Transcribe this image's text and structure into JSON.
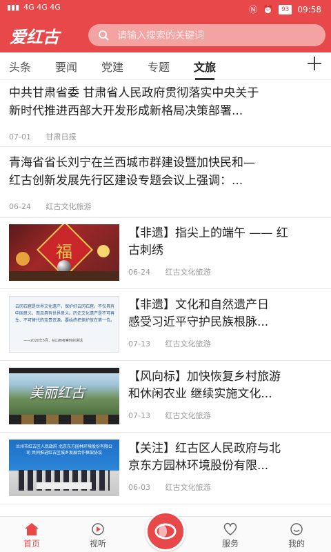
{
  "status_bar": {
    "left": "4G 4G 4G",
    "battery": "93",
    "time": "09:58"
  },
  "header": {
    "logo": "爱红古",
    "search_placeholder": "请输入搜索的关键词"
  },
  "tabs": [
    {
      "label": "头条"
    },
    {
      "label": "要闻"
    },
    {
      "label": "党建"
    },
    {
      "label": "专题"
    },
    {
      "label": "文旅"
    }
  ],
  "articles": [
    {
      "title_line1": "中共甘肃省委 甘肃省人民政府贯彻落实中央关于",
      "title_line2": "新时代推进西部大开发形成新格局决策部署...",
      "date": "07-01",
      "source": "甘肃日报"
    },
    {
      "title_line1": "青海省省长刘宁在兰西城市群建设暨加快民和—",
      "title_line2": "红古创新发展先行区建设专题会议上强调：...",
      "date": "06-24",
      "source": "红古文化旅游"
    }
  ],
  "cards": [
    {
      "title_line1": "【非遗】指尖上的端午 —— 红",
      "title_line2": "古刺绣",
      "date": "06-24",
      "source": "红古文化旅游",
      "thumb_text": "福"
    },
    {
      "title_line1": "【非遗】文化和自然遗产日",
      "title_line2": "感受习近平守护民族根脉...",
      "date": "07-13",
      "source": "红古文化旅游",
      "thumb_text": "云冈石窟是世界文化遗产，保护好云冈石窟，不仅具有中国意义，而且具有世界意义。历史文化遗产是不可再生、不可替代的宝贵资源，要始终把保护放在第一位。",
      "thumb_caption": "——2020年5月，在山西考察时的讲话"
    },
    {
      "title_line1": "【风向标】加快恢复乡村旅游",
      "title_line2": "和休闲农业 继续实施文化...",
      "date": "07-13",
      "source": "红古文化旅游",
      "thumb_text": "美丽红古"
    },
    {
      "title_line1": "【关注】红古区人民政府与北",
      "title_line2": "京东方园林环境股份有限...",
      "date": "06-03",
      "source": "红古文化旅游",
      "thumb_text": "兰州市红古区人民政府 北京东方园林环境股份有限公司 共同推进红古区城乡发展合作框架协议"
    }
  ],
  "bottom_nav": [
    {
      "label": "首页"
    },
    {
      "label": "视听"
    },
    {
      "label": "服务"
    },
    {
      "label": "我的"
    }
  ]
}
